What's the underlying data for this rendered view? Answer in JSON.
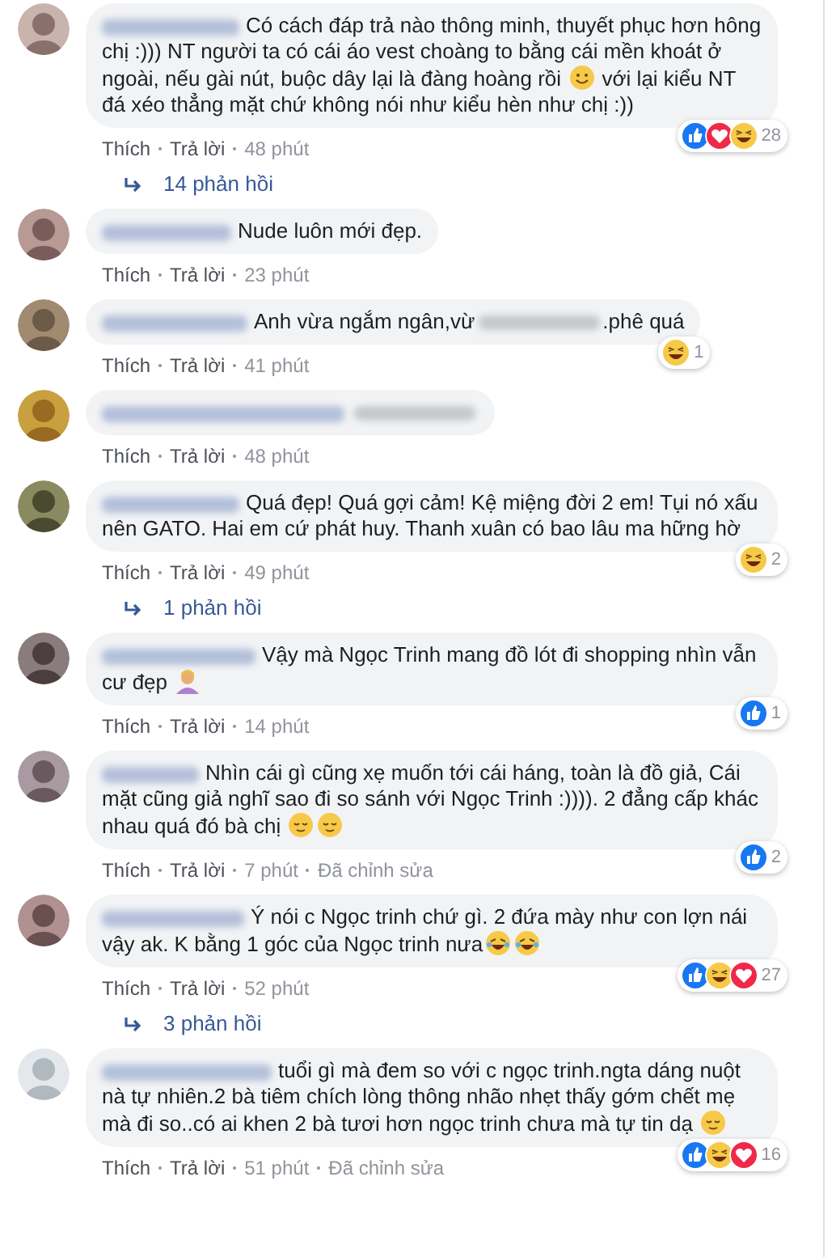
{
  "comments": [
    {
      "body": [
        {
          "kind": "text",
          "text": "Có cách đáp trả nào thông minh, thuyết phục hơn hông chị :))) NT người ta có cái áo vest choàng to bằng cái mền khoát ở ngoài, nếu gài nút, buộc dây lại là đàng hoàng rồi "
        },
        {
          "kind": "smile"
        },
        {
          "kind": "text",
          "text": " với lại kiểu NT đá xéo thẳng mặt chứ không nói như kiểu hèn như chị :))"
        }
      ],
      "reactions": {
        "icons": [
          {
            "kind": "like"
          },
          {
            "kind": "love"
          },
          {
            "kind": "haha"
          }
        ],
        "count": "28"
      },
      "like": "Thích",
      "reply": "Trả lời",
      "time": "48 phút",
      "replies": "14 phản hồi"
    },
    {
      "body": [
        {
          "kind": "text",
          "text": "Nude luôn mới đẹp."
        }
      ],
      "like": "Thích",
      "reply": "Trả lời",
      "time": "23 phút"
    },
    {
      "body": [
        {
          "kind": "text",
          "text": "Anh vừa ngắm ngân,vừ"
        },
        {
          "kind": "blur"
        },
        {
          "kind": "text",
          "text": ".phê quá"
        }
      ],
      "reactions": {
        "icons": [
          {
            "kind": "haha"
          }
        ],
        "count": "1"
      },
      "like": "Thích",
      "reply": "Trả lời",
      "time": "41 phút"
    },
    {
      "body": [
        {
          "kind": "blur"
        }
      ],
      "like": "Thích",
      "reply": "Trả lời",
      "time": "48 phút"
    },
    {
      "body": [
        {
          "kind": "text",
          "text": "Quá đẹp! Quá gợi cảm! Kệ miệng đời 2 em! Tụi nó xấu nên GATO. Hai em cứ phát huy. Thanh xuân có bao lâu ma hững hờ"
        }
      ],
      "reactions": {
        "icons": [
          {
            "kind": "haha"
          }
        ],
        "count": "2"
      },
      "like": "Thích",
      "reply": "Trả lời",
      "time": "49 phút",
      "replies": "1 phản hồi"
    },
    {
      "body": [
        {
          "kind": "text",
          "text": "Vậy mà Ngọc Trinh mang đồ lót đi shopping nhìn vẫn cư đẹp "
        },
        {
          "kind": "person"
        }
      ],
      "reactions": {
        "icons": [
          {
            "kind": "like"
          }
        ],
        "count": "1"
      },
      "like": "Thích",
      "reply": "Trả lời",
      "time": "14 phút"
    },
    {
      "body": [
        {
          "kind": "text",
          "text": "Nhìn cái gì cũng xẹ muốn tới cái háng, toàn là đồ giả, Cái mặt cũng giả nghĩ sao đi so sánh với Ngọc Trinh :)))). 2 đẳng cấp khác nhau quá đó bà chị "
        },
        {
          "kind": "relieved"
        },
        {
          "kind": "relieved"
        }
      ],
      "reactions": {
        "icons": [
          {
            "kind": "like"
          }
        ],
        "count": "2"
      },
      "like": "Thích",
      "reply": "Trả lời",
      "time": "7 phút",
      "edited": "Đã chỉnh sửa"
    },
    {
      "body": [
        {
          "kind": "text",
          "text": "Ý nói c Ngọc trinh chứ gì. 2 đứa mày như con lợn nái vậy ak. K bằng 1 góc của Ngọc trinh nưa"
        },
        {
          "kind": "rofl"
        },
        {
          "kind": "rofl"
        }
      ],
      "reactions": {
        "icons": [
          {
            "kind": "like"
          },
          {
            "kind": "haha"
          },
          {
            "kind": "love"
          }
        ],
        "count": "27"
      },
      "like": "Thích",
      "reply": "Trả lời",
      "time": "52 phút",
      "replies": "3 phản hồi"
    },
    {
      "body": [
        {
          "kind": "text",
          "text": "tuổi gì mà đem so với c ngọc trinh.ngta dáng nuột nà tự nhiên.2 bà tiêm chích lòng thông nhão nhẹt thấy gớm chết mẹ mà đi so..có ai khen 2 bà tươi hơn ngọc trinh chưa mà tự tin dạ "
        },
        {
          "kind": "relieved"
        }
      ],
      "reactions": {
        "icons": [
          {
            "kind": "like"
          },
          {
            "kind": "haha"
          },
          {
            "kind": "love"
          }
        ],
        "count": "16"
      },
      "like": "Thích",
      "reply": "Trả lời",
      "time": "51 phút",
      "edited": "Đã chỉnh sửa"
    }
  ]
}
